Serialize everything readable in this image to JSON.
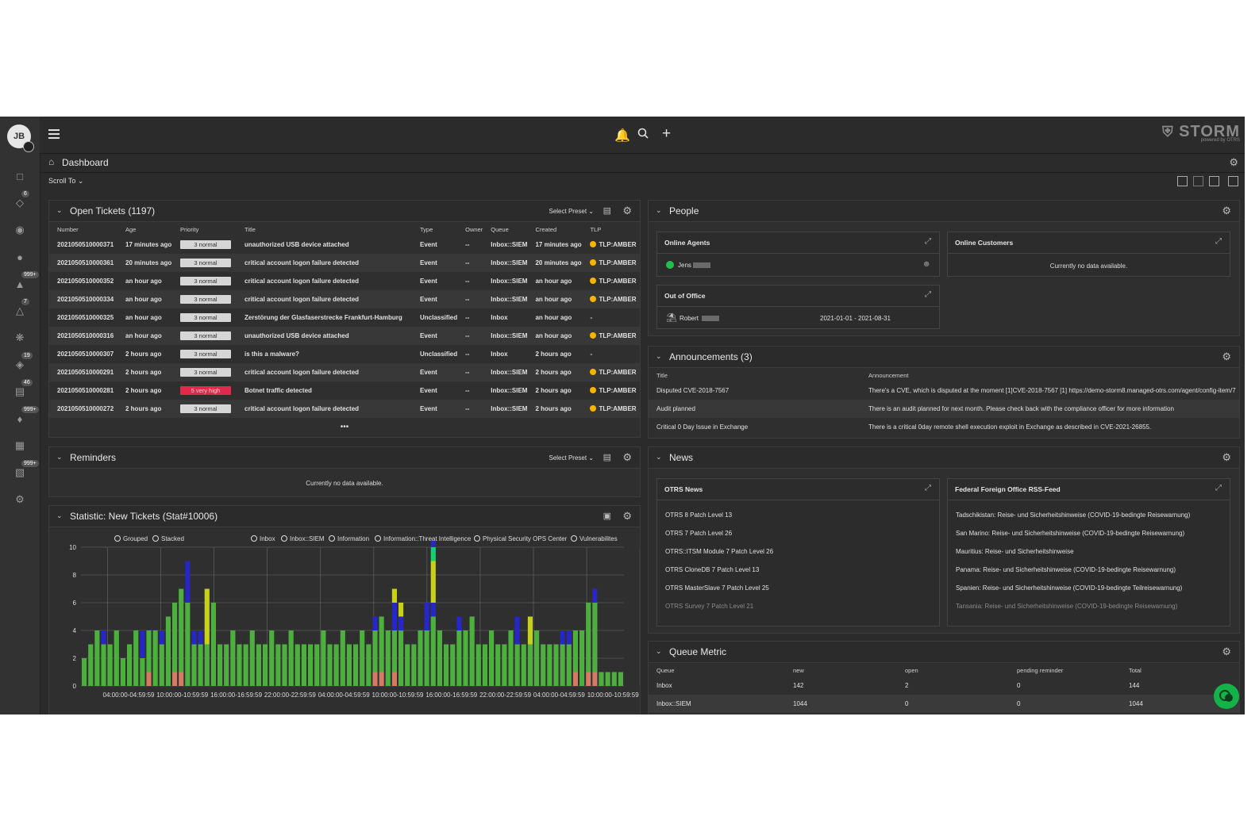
{
  "user": {
    "initials": "JB"
  },
  "sidebar": {
    "badges": [
      "6",
      "999+",
      "7",
      "19",
      "46",
      "999+",
      "999+"
    ]
  },
  "header": {
    "logo_main": "STORM",
    "logo_sub": "powered by OTRS"
  },
  "breadcrumb": {
    "title": "Dashboard"
  },
  "toolbar": {
    "scroll_to": "Scroll To"
  },
  "open_tickets": {
    "title": "Open Tickets (1197)",
    "preset": "Select Preset",
    "columns": [
      "Number",
      "Age",
      "Priority",
      "Title",
      "Type",
      "Owner",
      "Queue",
      "Created",
      "TLP"
    ],
    "rows": [
      {
        "number": "2021050510000371",
        "age": "17 minutes ago",
        "priority": "3 normal",
        "title": "unauthorized USB device attached",
        "type": "Event",
        "owner": "--",
        "queue": "Inbox::SIEM",
        "created": "17 minutes ago",
        "tlp": "TLP:AMBER"
      },
      {
        "number": "2021050510000361",
        "age": "20 minutes ago",
        "priority": "3 normal",
        "title": "critical account logon failure detected",
        "type": "Event",
        "owner": "--",
        "queue": "Inbox::SIEM",
        "created": "20 minutes ago",
        "tlp": "TLP:AMBER"
      },
      {
        "number": "2021050510000352",
        "age": "an hour ago",
        "priority": "3 normal",
        "title": "critical account logon failure detected",
        "type": "Event",
        "owner": "--",
        "queue": "Inbox::SIEM",
        "created": "an hour ago",
        "tlp": "TLP:AMBER"
      },
      {
        "number": "2021050510000334",
        "age": "an hour ago",
        "priority": "3 normal",
        "title": "critical account logon failure detected",
        "type": "Event",
        "owner": "--",
        "queue": "Inbox::SIEM",
        "created": "an hour ago",
        "tlp": "TLP:AMBER"
      },
      {
        "number": "2021050510000325",
        "age": "an hour ago",
        "priority": "3 normal",
        "title": "Zerstörung der Glasfaserstrecke Frankfurt-Hamburg",
        "type": "Unclassified",
        "owner": "--",
        "queue": "Inbox",
        "created": "an hour ago",
        "tlp": "-"
      },
      {
        "number": "2021050510000316",
        "age": "an hour ago",
        "priority": "3 normal",
        "title": "unauthorized USB device attached",
        "type": "Event",
        "owner": "--",
        "queue": "Inbox::SIEM",
        "created": "an hour ago",
        "tlp": "TLP:AMBER"
      },
      {
        "number": "2021050510000307",
        "age": "2 hours ago",
        "priority": "3 normal",
        "title": "is this a malware?",
        "type": "Unclassified",
        "owner": "--",
        "queue": "Inbox",
        "created": "2 hours ago",
        "tlp": "-"
      },
      {
        "number": "2021050510000291",
        "age": "2 hours ago",
        "priority": "3 normal",
        "title": "critical account logon failure detected",
        "type": "Event",
        "owner": "--",
        "queue": "Inbox::SIEM",
        "created": "2 hours ago",
        "tlp": "TLP:AMBER"
      },
      {
        "number": "2021050510000281",
        "age": "2 hours ago",
        "priority": "5 very high",
        "title": "Botnet traffic detected",
        "type": "Event",
        "owner": "--",
        "queue": "Inbox::SIEM",
        "created": "2 hours ago",
        "tlp": "TLP:AMBER"
      },
      {
        "number": "2021050510000272",
        "age": "2 hours ago",
        "priority": "3 normal",
        "title": "critical account logon failure detected",
        "type": "Event",
        "owner": "--",
        "queue": "Inbox::SIEM",
        "created": "2 hours ago",
        "tlp": "TLP:AMBER"
      }
    ],
    "more": "•••"
  },
  "reminders": {
    "title": "Reminders",
    "preset": "Select Preset",
    "empty": "Currently no data available."
  },
  "statistic": {
    "title": "Statistic: New Tickets (Stat#10006)",
    "modes": [
      "Grouped",
      "Stacked"
    ],
    "legend": [
      "Inbox",
      "Inbox::SIEM",
      "Information",
      "Information::Threat Intelligence",
      "Physical Security OPS Center",
      "Vulnerabilites"
    ]
  },
  "chart_data": {
    "type": "bar",
    "stacked": true,
    "ylim": [
      0,
      10
    ],
    "yticks": [
      0,
      2,
      4,
      6,
      8,
      10
    ],
    "xtick_labels": [
      "04:00:00-04:59:59",
      "10:00:00-10:59:59",
      "16:00:00-16:59:59",
      "22:00:00-22:59:59",
      "04:00:00-04:59:59",
      "10:00:00-10:59:59",
      "16:00:00-16:59:59",
      "22:00:00-22:59:59",
      "04:00:00-04:59:59",
      "10:00:00-10:59:59"
    ],
    "series_colors": {
      "green": "#4caf3e",
      "blue": "#2727c8",
      "yellow": "#c8d11a",
      "salmon": "#d67a63",
      "brightgreen": "#15d36a"
    },
    "series": [
      {
        "color": "salmon",
        "values": [
          0,
          0,
          0,
          0,
          0,
          0,
          0,
          0,
          0,
          0,
          1,
          0,
          0,
          0,
          1,
          1,
          0,
          0,
          0,
          0,
          0,
          0,
          0,
          0,
          0,
          0,
          0,
          0,
          0,
          0,
          0,
          0,
          0,
          0,
          0,
          0,
          0,
          0,
          0,
          0,
          0,
          0,
          0,
          0,
          0,
          1,
          1,
          0,
          1,
          0,
          0,
          0,
          0,
          0,
          0,
          0,
          0,
          0,
          0,
          0,
          0,
          0,
          0,
          0,
          0,
          0,
          0,
          0,
          0,
          0,
          0,
          0,
          0,
          0,
          0,
          0,
          1,
          0,
          1,
          1,
          0,
          0,
          0,
          0
        ]
      },
      {
        "color": "green",
        "values": [
          2,
          3,
          4,
          3,
          3,
          4,
          2,
          3,
          4,
          2,
          3,
          4,
          3,
          5,
          5,
          6,
          6,
          3,
          3,
          3,
          6,
          3,
          3,
          4,
          3,
          3,
          4,
          3,
          3,
          4,
          3,
          3,
          4,
          3,
          3,
          3,
          3,
          4,
          3,
          3,
          4,
          3,
          3,
          4,
          3,
          3,
          4,
          4,
          3,
          4,
          3,
          3,
          4,
          4,
          5,
          4,
          3,
          3,
          4,
          4,
          5,
          3,
          3,
          4,
          3,
          3,
          4,
          3,
          3,
          3,
          4,
          3,
          3,
          3,
          3,
          3,
          3,
          4,
          5,
          5,
          1,
          1,
          1,
          1
        ]
      },
      {
        "color": "blue",
        "values": [
          0,
          0,
          0,
          1,
          0,
          0,
          0,
          0,
          0,
          2,
          0,
          0,
          1,
          0,
          0,
          0,
          3,
          1,
          1,
          0,
          0,
          0,
          0,
          0,
          0,
          0,
          0,
          0,
          0,
          0,
          0,
          0,
          0,
          0,
          0,
          0,
          0,
          0,
          0,
          0,
          0,
          0,
          0,
          0,
          0,
          1,
          0,
          0,
          2,
          1,
          0,
          0,
          0,
          2,
          1,
          0,
          0,
          0,
          1,
          0,
          0,
          0,
          0,
          0,
          0,
          0,
          0,
          2,
          0,
          0,
          0,
          0,
          0,
          0,
          1,
          1,
          0,
          0,
          0,
          1,
          0,
          0,
          0,
          0
        ]
      },
      {
        "color": "yellow",
        "values": [
          0,
          0,
          0,
          0,
          0,
          0,
          0,
          0,
          0,
          0,
          0,
          0,
          0,
          0,
          0,
          0,
          0,
          0,
          0,
          4,
          0,
          0,
          0,
          0,
          0,
          0,
          0,
          0,
          0,
          0,
          0,
          0,
          0,
          0,
          0,
          0,
          0,
          0,
          0,
          0,
          0,
          0,
          0,
          0,
          0,
          0,
          0,
          0,
          1,
          1,
          0,
          0,
          0,
          0,
          3,
          0,
          0,
          0,
          0,
          0,
          0,
          0,
          0,
          0,
          0,
          0,
          0,
          0,
          0,
          2,
          0,
          0,
          0,
          0,
          0,
          0,
          0,
          0,
          0,
          0,
          0,
          0,
          0,
          0
        ]
      },
      {
        "color": "brightgreen",
        "values": [
          0,
          0,
          0,
          0,
          0,
          0,
          0,
          0,
          0,
          0,
          0,
          0,
          0,
          0,
          0,
          0,
          0,
          0,
          0,
          0,
          0,
          0,
          0,
          0,
          0,
          0,
          0,
          0,
          0,
          0,
          0,
          0,
          0,
          0,
          0,
          0,
          0,
          0,
          0,
          0,
          0,
          0,
          0,
          0,
          0,
          0,
          0,
          0,
          0,
          0,
          0,
          0,
          0,
          0,
          1,
          0,
          0,
          0,
          0,
          0,
          0,
          0,
          0,
          0,
          0,
          0,
          0,
          0,
          0,
          0,
          0,
          0,
          0,
          0,
          0,
          0,
          0,
          0,
          0,
          0,
          0,
          0,
          0,
          0
        ]
      },
      {
        "color": "blue",
        "values": [
          0,
          0,
          0,
          0,
          0,
          0,
          0,
          0,
          0,
          0,
          0,
          0,
          0,
          0,
          0,
          0,
          0,
          0,
          0,
          0,
          0,
          0,
          0,
          0,
          0,
          0,
          0,
          0,
          0,
          0,
          0,
          0,
          0,
          0,
          0,
          0,
          0,
          0,
          0,
          0,
          0,
          0,
          0,
          0,
          0,
          0,
          0,
          0,
          0,
          0,
          0,
          0,
          0,
          0,
          2,
          0,
          0,
          0,
          0,
          0,
          0,
          0,
          0,
          0,
          0,
          0,
          0,
          0,
          0,
          0,
          0,
          0,
          0,
          0,
          0,
          0,
          0,
          0,
          0,
          0,
          0,
          0,
          0,
          0
        ]
      }
    ]
  },
  "people": {
    "title": "People",
    "online_agents": {
      "title": "Online Agents",
      "name": "Jens"
    },
    "online_customers": {
      "title": "Online Customers",
      "empty": "Currently no data available."
    },
    "out_of_office": {
      "title": "Out of Office",
      "name": "Robert",
      "dates": "2021-01-01 - 2021-08-31"
    }
  },
  "announcements": {
    "title": "Announcements (3)",
    "columns": [
      "Title",
      "Announcement"
    ],
    "rows": [
      {
        "title": "Disputed CVE-2018-7567",
        "text": "There's a CVE, which is disputed at the moment [1]CVE-2018-7567 [1] https://demo-storm8.managed-otrs.com/agent/config-item/7"
      },
      {
        "title": "Audit planned",
        "text": "There is an audit planned for next month. Please check back with the compliance officer for more information"
      },
      {
        "title": "Critical 0 Day Issue in Exchange",
        "text": "There is a critical 0day remote shell execution exploit in Exchange as described in CVE-2021-26855."
      }
    ]
  },
  "news": {
    "title": "News",
    "otrs": {
      "title": "OTRS News",
      "items": [
        "OTRS 8 Patch Level 13",
        "OTRS 7 Patch Level 26",
        "OTRS::ITSM Module 7 Patch Level 26",
        "OTRS CloneDB 7 Patch Level 13",
        "OTRS MasterSlave 7 Patch Level 25",
        "OTRS Survey 7 Patch Level 21"
      ]
    },
    "ffo": {
      "title": "Federal Foreign Office RSS-Feed",
      "items": [
        "Tadschikistan: Reise- und Sicherheitshinweise (COVID-19-bedingte Reisewarnung)",
        "San Marino: Reise- und Sicherheitshinweise (COVID-19-bedingte Reisewarnung)",
        "Mauritius: Reise- und Sicherheitshinweise",
        "Panama: Reise- und Sicherheitshinweise (COVID-19-bedingte Reisewarnung)",
        "Spanien: Reise- und Sicherheitshinweise (COVID-19-bedingte Teilreisewarnung)",
        "Tansania: Reise- und Sicherheitshinweise (COVID-19-bedingte Reisewarnung)"
      ]
    }
  },
  "queue_metric": {
    "title": "Queue Metric",
    "columns": [
      "Queue",
      "new",
      "open",
      "pending reminder",
      "Total"
    ],
    "rows": [
      {
        "queue": "Inbox",
        "new": "142",
        "open": "2",
        "pending": "0",
        "total": "144"
      },
      {
        "queue": "Inbox::SIEM",
        "new": "1044",
        "open": "0",
        "pending": "0",
        "total": "1044"
      }
    ]
  }
}
